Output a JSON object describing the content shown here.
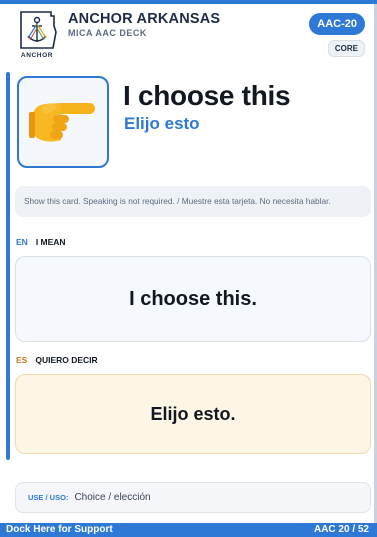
{
  "header": {
    "logo_text": "ANCHOR",
    "title": "ANCHOR ARKANSAS",
    "subtitle": "MICA AAC DECK",
    "code_badge": "AAC-20",
    "category_badge": "CORE"
  },
  "hero": {
    "icon": "pointing-hand-icon",
    "title": "I choose this",
    "subtitle": "Elijo esto"
  },
  "instruction": "Show this card. Speaking is not required. / Muestre esta tarjeta. No necesita hablar.",
  "english": {
    "lang": "EN",
    "heading": "I MEAN",
    "text": "I choose this."
  },
  "spanish": {
    "lang": "ES",
    "heading": "QUIERO DECIR",
    "text": "Elijo esto."
  },
  "use": {
    "label": "USE / USO:",
    "text": "Choice / elección"
  },
  "footer": {
    "left": "Dock Here for Support",
    "right": "AAC 20 / 52"
  },
  "colors": {
    "accent": "#2f79d6",
    "spanish_card": "#fdf5e6",
    "english_card": "#f5f8fc"
  }
}
